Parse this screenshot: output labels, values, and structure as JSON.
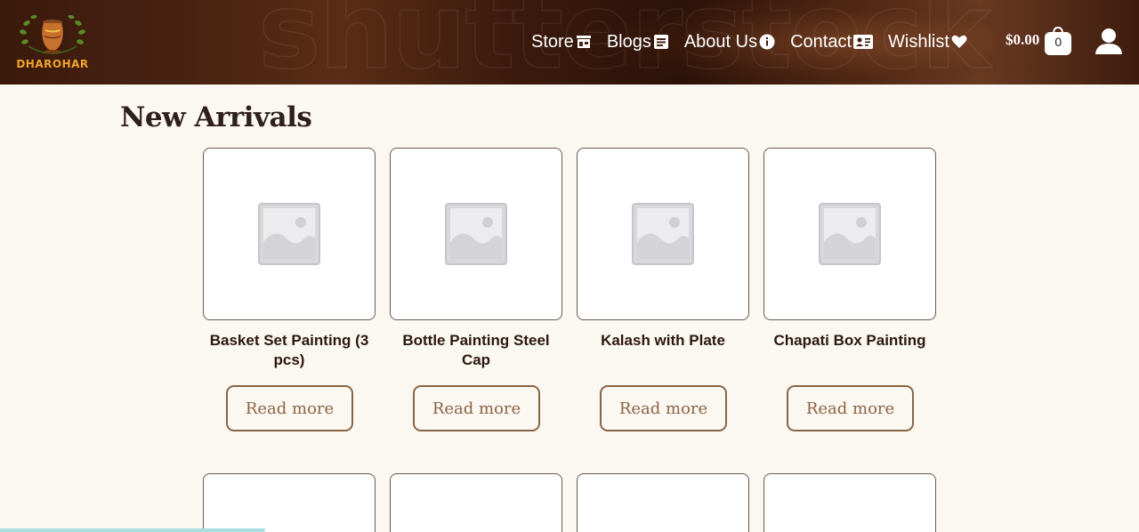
{
  "header": {
    "logo_text": "DHAROHAR",
    "watermark": "shutterstock",
    "nav": [
      {
        "label": "Store",
        "icon": "store-icon"
      },
      {
        "label": "Blogs",
        "icon": "document-icon"
      },
      {
        "label": "About Us",
        "icon": "info-icon"
      },
      {
        "label": "Contact",
        "icon": "contact-card-icon"
      },
      {
        "label": "Wishlist",
        "icon": "heart-icon"
      }
    ],
    "cart_total": "$0.00",
    "cart_count": "0",
    "account_icon": "user-icon"
  },
  "main": {
    "title": "New Arrivals",
    "products": [
      {
        "name": "Basket Set Painting (3 pcs)",
        "button": "Read more"
      },
      {
        "name": "Bottle Painting Steel Cap",
        "button": "Read more"
      },
      {
        "name": "Kalash with Plate",
        "button": "Read more"
      },
      {
        "name": "Chapati Box Painting",
        "button": "Read more"
      }
    ]
  },
  "colors": {
    "accent": "#8a6545",
    "background": "#fbf7f1",
    "logo": "#f2a52c"
  }
}
